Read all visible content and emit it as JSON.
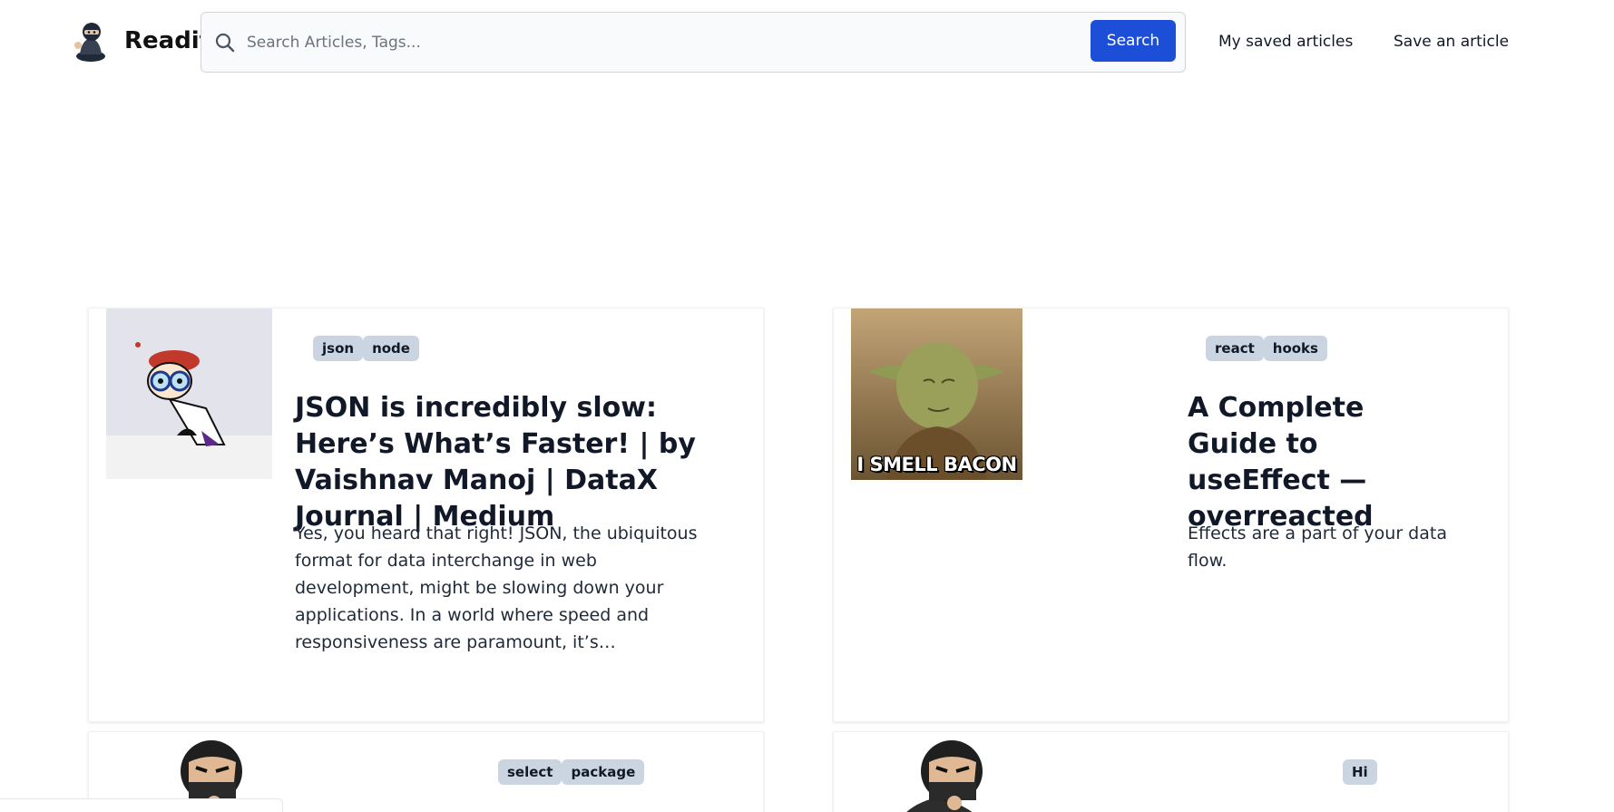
{
  "header": {
    "brand": "Readit",
    "search": {
      "placeholder": "Search Articles, Tags...",
      "value": "",
      "button_label": "Search"
    },
    "nav": {
      "saved_label": "My saved articles",
      "save_label": "Save an article"
    }
  },
  "articles": [
    {
      "tags": [
        "json",
        "node"
      ],
      "title": "JSON is incredibly slow: Here’s What’s Faster! | by Vaishnav Manoj | DataX Journal | Medium",
      "description": "Yes, you heard that right! JSON, the ubiquitous format for data interchange in web development, might be slowing down your applications. In a world where speed and responsiveness are paramount, it’s…",
      "thumbnail": "cartoon-scientist-image"
    },
    {
      "tags": [
        "react",
        "hooks"
      ],
      "title": "A Complete Guide to useEffect — overreacted",
      "description": "Effects are a part of your data flow.",
      "thumbnail": "yoda-meme-image",
      "thumbnail_caption": "I SMELL BACON"
    },
    {
      "tags": [
        "select",
        "package"
      ],
      "thumbnail": "ninja-avatar-image"
    },
    {
      "tags": [
        "Hi"
      ],
      "thumbnail": "ninja-avatar-image"
    }
  ],
  "colors": {
    "primary": "#1d4ed8",
    "tag_bg": "#cbd5e1",
    "text": "#111827"
  }
}
